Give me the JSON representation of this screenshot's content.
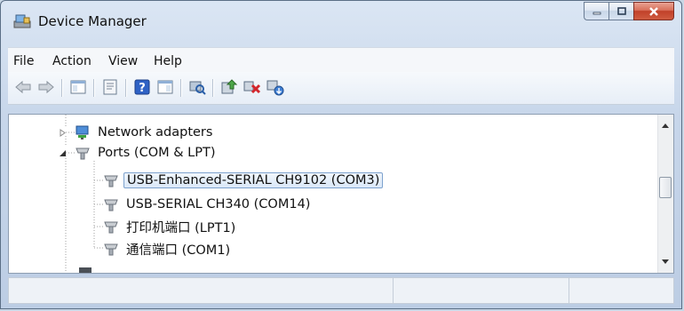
{
  "window": {
    "title": "Device Manager",
    "title_icon": "device-manager-icon"
  },
  "caption_buttons": {
    "minimize_icon": "minimize-icon",
    "maximize_icon": "maximize-icon",
    "close_icon": "close-icon"
  },
  "menu": [
    "File",
    "Action",
    "View",
    "Help"
  ],
  "toolbar": [
    "back-arrow-icon",
    "forward-arrow-icon",
    "show-hide-console-tree-icon",
    "properties-icon",
    "help-icon",
    "show-hide-action-pane-icon",
    "scan-hardware-icon",
    "update-driver-icon",
    "disable-device-icon",
    "uninstall-device-icon"
  ],
  "tree": {
    "rows": [
      {
        "label": "Network adapters",
        "icon": "network-adapter-icon",
        "expander": "collapsed"
      },
      {
        "label": "Ports (COM & LPT)",
        "icon": "port-icon",
        "expander": "expanded"
      },
      {
        "label": "USB-Enhanced-SERIAL CH9102 (COM3)",
        "icon": "port-icon",
        "selected": true
      },
      {
        "label": "USB-SERIAL CH340 (COM14)",
        "icon": "port-icon"
      },
      {
        "label": "打印机端口 (LPT1)",
        "icon": "port-icon"
      },
      {
        "label": "通信端口 (COM1)",
        "icon": "port-icon"
      }
    ]
  },
  "colors": {
    "selection": "#dae8f8",
    "close_button": "#c1412a"
  }
}
